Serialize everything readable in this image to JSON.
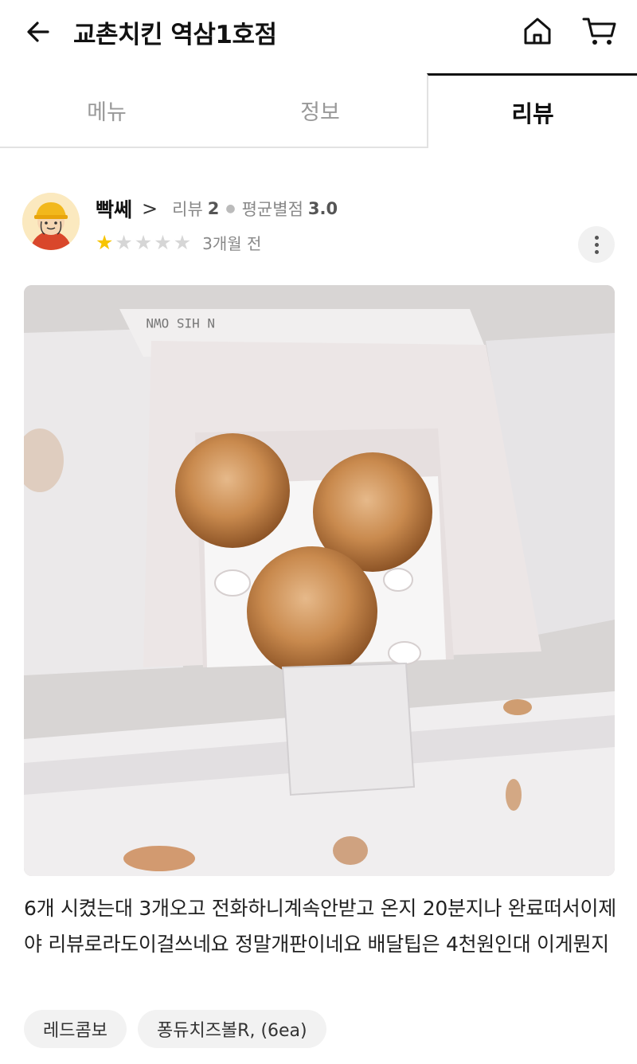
{
  "header": {
    "title": "교촌치킨 역삼1호점",
    "back_icon": "arrow-left-icon",
    "home_icon": "home-icon",
    "cart_icon": "cart-icon"
  },
  "tabs": [
    {
      "label": "메뉴",
      "active": false
    },
    {
      "label": "정보",
      "active": false
    },
    {
      "label": "리뷰",
      "active": true
    }
  ],
  "review": {
    "reviewer_name": "빡쎄",
    "review_count_label": "리뷰",
    "review_count": "2",
    "avg_rating_label": "평균별점",
    "avg_rating": "3.0",
    "rating": 1,
    "max_rating": 5,
    "date": "3개월 전",
    "photo_alt": "주문한 음식 사진",
    "text": "6개 시켰는대 3개오고 전화하니계속안받고 온지 20분지나 완료떠서이제야 리뷰로라도이걸쓰네요  정말개판이네요 배달팁은 4천원인대 이게뭔지",
    "menu_items": [
      "레드콤보",
      "퐁듀치즈볼R, (6ea)"
    ]
  },
  "colors": {
    "star_filled": "#f7c400",
    "star_empty": "#d6d6d6",
    "active_tab": "#111111",
    "inactive_tab": "#999999"
  }
}
